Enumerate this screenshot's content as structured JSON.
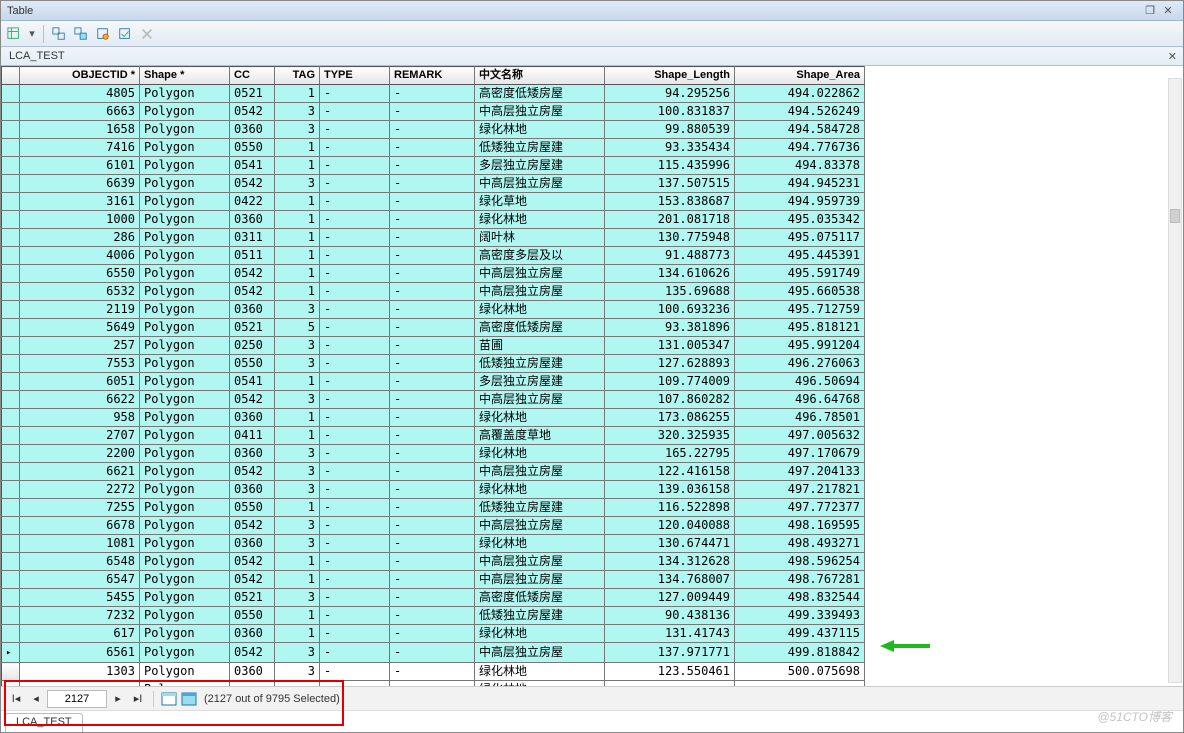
{
  "window": {
    "title": "Table"
  },
  "tableName": "LCA_TEST",
  "headers": {
    "objectid": "OBJECTID *",
    "shape": "Shape *",
    "cc": "CC",
    "tag": "TAG",
    "type": "TYPE",
    "remark": "REMARK",
    "cn": "中文名称",
    "len": "Shape_Length",
    "area": "Shape_Area"
  },
  "rows": [
    {
      "sel": true,
      "obj": "4805",
      "shape": "Polygon",
      "cc": "0521",
      "tag": "1",
      "type": "-",
      "remark": "-",
      "cn": "高密度低矮房屋",
      "len": "94.295256",
      "area": "494.022862"
    },
    {
      "sel": true,
      "obj": "6663",
      "shape": "Polygon",
      "cc": "0542",
      "tag": "3",
      "type": "-",
      "remark": "-",
      "cn": "中高层独立房屋",
      "len": "100.831837",
      "area": "494.526249"
    },
    {
      "sel": true,
      "obj": "1658",
      "shape": "Polygon",
      "cc": "0360",
      "tag": "3",
      "type": "-",
      "remark": "-",
      "cn": "绿化林地",
      "len": "99.880539",
      "area": "494.584728"
    },
    {
      "sel": true,
      "obj": "7416",
      "shape": "Polygon",
      "cc": "0550",
      "tag": "1",
      "type": "-",
      "remark": "-",
      "cn": "低矮独立房屋建",
      "len": "93.335434",
      "area": "494.776736"
    },
    {
      "sel": true,
      "obj": "6101",
      "shape": "Polygon",
      "cc": "0541",
      "tag": "1",
      "type": "-",
      "remark": "-",
      "cn": "多层独立房屋建",
      "len": "115.435996",
      "area": "494.83378"
    },
    {
      "sel": true,
      "obj": "6639",
      "shape": "Polygon",
      "cc": "0542",
      "tag": "3",
      "type": "-",
      "remark": "-",
      "cn": "中高层独立房屋",
      "len": "137.507515",
      "area": "494.945231"
    },
    {
      "sel": true,
      "obj": "3161",
      "shape": "Polygon",
      "cc": "0422",
      "tag": "1",
      "type": "-",
      "remark": "-",
      "cn": "绿化草地",
      "len": "153.838687",
      "area": "494.959739"
    },
    {
      "sel": true,
      "obj": "1000",
      "shape": "Polygon",
      "cc": "0360",
      "tag": "1",
      "type": "-",
      "remark": "-",
      "cn": "绿化林地",
      "len": "201.081718",
      "area": "495.035342"
    },
    {
      "sel": true,
      "obj": "286",
      "shape": "Polygon",
      "cc": "0311",
      "tag": "1",
      "type": "-",
      "remark": "-",
      "cn": "阔叶林",
      "len": "130.775948",
      "area": "495.075117"
    },
    {
      "sel": true,
      "obj": "4006",
      "shape": "Polygon",
      "cc": "0511",
      "tag": "1",
      "type": "-",
      "remark": "-",
      "cn": "高密度多层及以",
      "len": "91.488773",
      "area": "495.445391"
    },
    {
      "sel": true,
      "obj": "6550",
      "shape": "Polygon",
      "cc": "0542",
      "tag": "1",
      "type": "-",
      "remark": "-",
      "cn": "中高层独立房屋",
      "len": "134.610626",
      "area": "495.591749"
    },
    {
      "sel": true,
      "obj": "6532",
      "shape": "Polygon",
      "cc": "0542",
      "tag": "1",
      "type": "-",
      "remark": "-",
      "cn": "中高层独立房屋",
      "len": "135.69688",
      "area": "495.660538"
    },
    {
      "sel": true,
      "obj": "2119",
      "shape": "Polygon",
      "cc": "0360",
      "tag": "3",
      "type": "-",
      "remark": "-",
      "cn": "绿化林地",
      "len": "100.693236",
      "area": "495.712759"
    },
    {
      "sel": true,
      "obj": "5649",
      "shape": "Polygon",
      "cc": "0521",
      "tag": "5",
      "type": "-",
      "remark": "-",
      "cn": "高密度低矮房屋",
      "len": "93.381896",
      "area": "495.818121"
    },
    {
      "sel": true,
      "obj": "257",
      "shape": "Polygon",
      "cc": "0250",
      "tag": "3",
      "type": "-",
      "remark": "-",
      "cn": "苗圃",
      "len": "131.005347",
      "area": "495.991204"
    },
    {
      "sel": true,
      "obj": "7553",
      "shape": "Polygon",
      "cc": "0550",
      "tag": "3",
      "type": "-",
      "remark": "-",
      "cn": "低矮独立房屋建",
      "len": "127.628893",
      "area": "496.276063"
    },
    {
      "sel": true,
      "obj": "6051",
      "shape": "Polygon",
      "cc": "0541",
      "tag": "1",
      "type": "-",
      "remark": "-",
      "cn": "多层独立房屋建",
      "len": "109.774009",
      "area": "496.50694"
    },
    {
      "sel": true,
      "obj": "6622",
      "shape": "Polygon",
      "cc": "0542",
      "tag": "3",
      "type": "-",
      "remark": "-",
      "cn": "中高层独立房屋",
      "len": "107.860282",
      "area": "496.64768"
    },
    {
      "sel": true,
      "obj": "958",
      "shape": "Polygon",
      "cc": "0360",
      "tag": "1",
      "type": "-",
      "remark": "-",
      "cn": "绿化林地",
      "len": "173.086255",
      "area": "496.78501"
    },
    {
      "sel": true,
      "obj": "2707",
      "shape": "Polygon",
      "cc": "0411",
      "tag": "1",
      "type": "-",
      "remark": "-",
      "cn": "高覆盖度草地",
      "len": "320.325935",
      "area": "497.005632"
    },
    {
      "sel": true,
      "obj": "2200",
      "shape": "Polygon",
      "cc": "0360",
      "tag": "3",
      "type": "-",
      "remark": "-",
      "cn": "绿化林地",
      "len": "165.22795",
      "area": "497.170679"
    },
    {
      "sel": true,
      "obj": "6621",
      "shape": "Polygon",
      "cc": "0542",
      "tag": "3",
      "type": "-",
      "remark": "-",
      "cn": "中高层独立房屋",
      "len": "122.416158",
      "area": "497.204133"
    },
    {
      "sel": true,
      "obj": "2272",
      "shape": "Polygon",
      "cc": "0360",
      "tag": "3",
      "type": "-",
      "remark": "-",
      "cn": "绿化林地",
      "len": "139.036158",
      "area": "497.217821"
    },
    {
      "sel": true,
      "obj": "7255",
      "shape": "Polygon",
      "cc": "0550",
      "tag": "1",
      "type": "-",
      "remark": "-",
      "cn": "低矮独立房屋建",
      "len": "116.522898",
      "area": "497.772377"
    },
    {
      "sel": true,
      "obj": "6678",
      "shape": "Polygon",
      "cc": "0542",
      "tag": "3",
      "type": "-",
      "remark": "-",
      "cn": "中高层独立房屋",
      "len": "120.040088",
      "area": "498.169595"
    },
    {
      "sel": true,
      "obj": "1081",
      "shape": "Polygon",
      "cc": "0360",
      "tag": "3",
      "type": "-",
      "remark": "-",
      "cn": "绿化林地",
      "len": "130.674471",
      "area": "498.493271"
    },
    {
      "sel": true,
      "obj": "6548",
      "shape": "Polygon",
      "cc": "0542",
      "tag": "1",
      "type": "-",
      "remark": "-",
      "cn": "中高层独立房屋",
      "len": "134.312628",
      "area": "498.596254"
    },
    {
      "sel": true,
      "obj": "6547",
      "shape": "Polygon",
      "cc": "0542",
      "tag": "1",
      "type": "-",
      "remark": "-",
      "cn": "中高层独立房屋",
      "len": "134.768007",
      "area": "498.767281"
    },
    {
      "sel": true,
      "obj": "5455",
      "shape": "Polygon",
      "cc": "0521",
      "tag": "3",
      "type": "-",
      "remark": "-",
      "cn": "高密度低矮房屋",
      "len": "127.009449",
      "area": "498.832544"
    },
    {
      "sel": true,
      "obj": "7232",
      "shape": "Polygon",
      "cc": "0550",
      "tag": "1",
      "type": "-",
      "remark": "-",
      "cn": "低矮独立房屋建",
      "len": "90.438136",
      "area": "499.339493"
    },
    {
      "sel": true,
      "obj": "617",
      "shape": "Polygon",
      "cc": "0360",
      "tag": "1",
      "type": "-",
      "remark": "-",
      "cn": "绿化林地",
      "len": "131.41743",
      "area": "499.437115"
    },
    {
      "sel": true,
      "cur": true,
      "obj": "6561",
      "shape": "Polygon",
      "cc": "0542",
      "tag": "3",
      "type": "-",
      "remark": "-",
      "cn": "中高层独立房屋",
      "len": "137.971771",
      "area": "499.818842"
    },
    {
      "sel": false,
      "obj": "1303",
      "shape": "Polygon",
      "cc": "0360",
      "tag": "3",
      "type": "-",
      "remark": "-",
      "cn": "绿化林地",
      "len": "123.550461",
      "area": "500.075698"
    },
    {
      "sel": false,
      "obj": "",
      "shape": "Polygon",
      "cc": "",
      "tag": "",
      "type": "-",
      "remark": "-",
      "cn": "绿化林地",
      "len": "",
      "area": ""
    }
  ],
  "nav": {
    "record": "2127",
    "status": "(2127 out of 9795 Selected)"
  },
  "tabs": {
    "active": "LCA_TEST"
  },
  "watermark": "@51CTO博客"
}
